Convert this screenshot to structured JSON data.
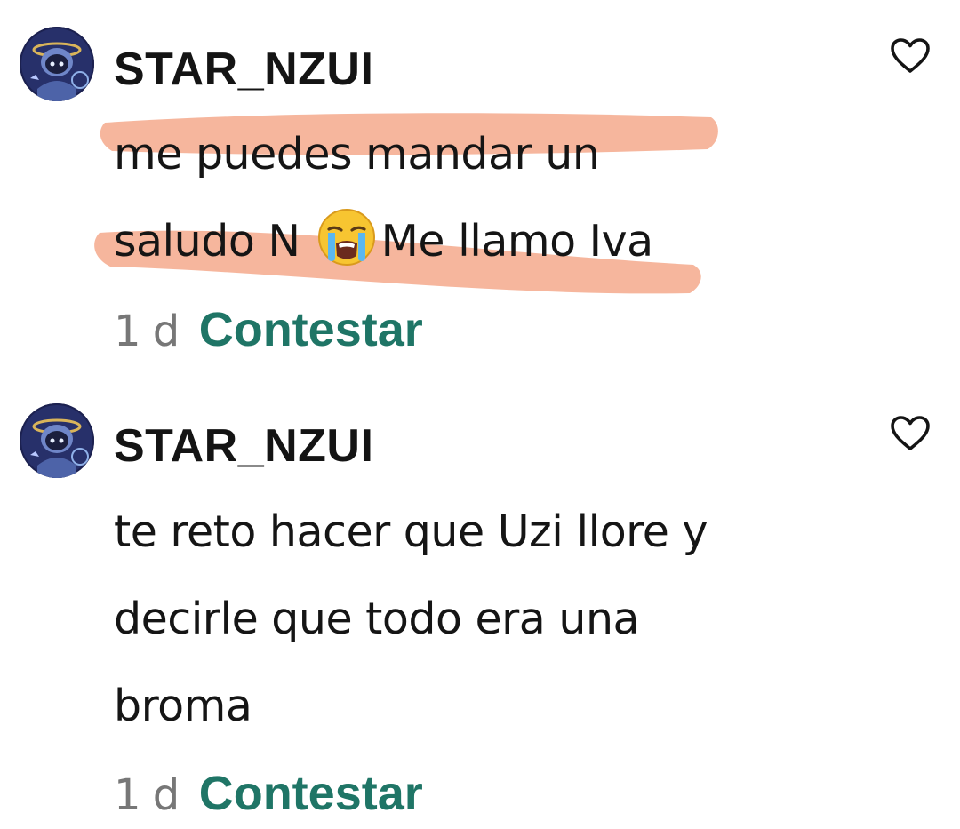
{
  "comments": [
    {
      "username": "STAR_NZUI",
      "text_lines": [
        "me puedes mandar un",
        "saludo N",
        "Me llamo Iva"
      ],
      "emoji": "loudly-crying-face",
      "time": "1 d",
      "reply_label": "Contestar",
      "highlight_color": "#f4a688"
    },
    {
      "username": "STAR_NZUI",
      "text_lines": [
        "te reto hacer que Uzi llore y",
        "decirle que todo era una",
        "broma"
      ],
      "time": "1 d",
      "reply_label": "Contestar"
    }
  ],
  "colors": {
    "reply_link": "#1f7566",
    "timestamp": "#777777",
    "highlighter": "#f4a688"
  },
  "icons": {
    "like": "heart-outline-icon",
    "avatar": "robot-avatar-image"
  }
}
